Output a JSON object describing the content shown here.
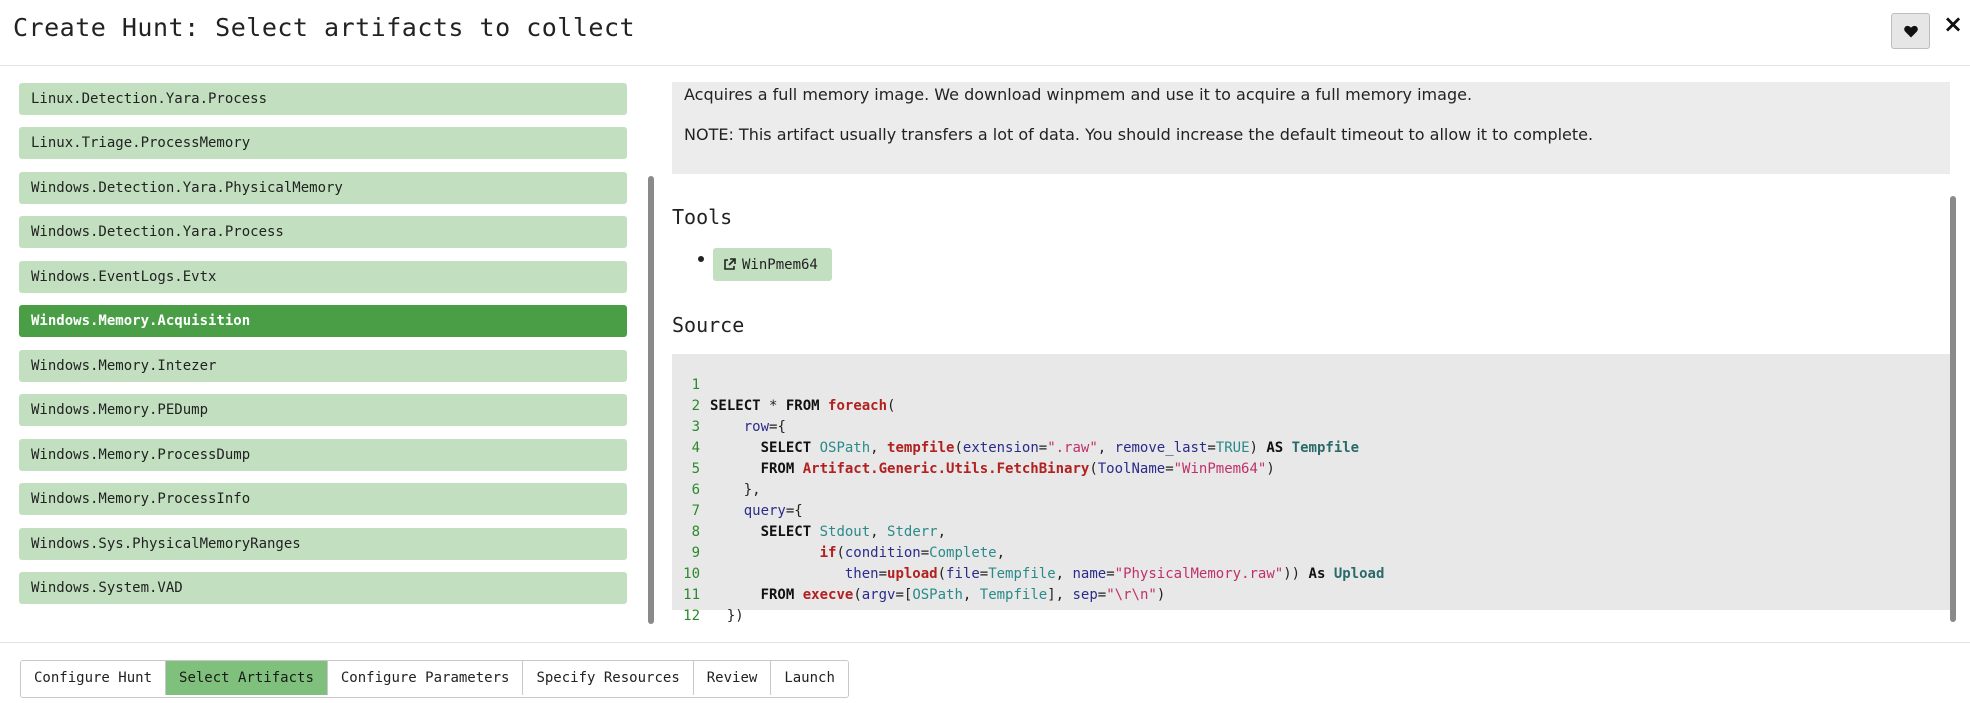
{
  "header": {
    "title": "Create Hunt: Select artifacts to collect",
    "favorite_icon": "heart-icon",
    "close_label": "×"
  },
  "artifacts": [
    {
      "label": "Linux.Detection.Yara.Process",
      "selected": false
    },
    {
      "label": "Linux.Triage.ProcessMemory",
      "selected": false
    },
    {
      "label": "Windows.Detection.Yara.PhysicalMemory",
      "selected": false
    },
    {
      "label": "Windows.Detection.Yara.Process",
      "selected": false
    },
    {
      "label": "Windows.EventLogs.Evtx",
      "selected": false
    },
    {
      "label": "Windows.Memory.Acquisition",
      "selected": true
    },
    {
      "label": "Windows.Memory.Intezer",
      "selected": false
    },
    {
      "label": "Windows.Memory.PEDump",
      "selected": false
    },
    {
      "label": "Windows.Memory.ProcessDump",
      "selected": false
    },
    {
      "label": "Windows.Memory.ProcessInfo",
      "selected": false
    },
    {
      "label": "Windows.Sys.PhysicalMemoryRanges",
      "selected": false
    },
    {
      "label": "Windows.System.VAD",
      "selected": false
    }
  ],
  "description": {
    "paragraph1": "Acquires a full memory image. We download winpmem and use it to acquire a full memory image.",
    "paragraph2": "NOTE: This artifact usually transfers a lot of data. You should increase the default timeout to allow it to complete."
  },
  "tools": {
    "heading": "Tools",
    "items": [
      {
        "label": "WinPmem64",
        "icon": "external-link-icon"
      }
    ]
  },
  "source": {
    "heading": "Source",
    "line_numbers": [
      "1",
      "2",
      "3",
      "4",
      "5",
      "6",
      "7",
      "8",
      "9",
      "10",
      "11",
      "12"
    ]
  },
  "footer": {
    "tabs": [
      {
        "label": "Configure Hunt",
        "active": false
      },
      {
        "label": "Select Artifacts",
        "active": true
      },
      {
        "label": "Configure Parameters",
        "active": false
      },
      {
        "label": "Specify Resources",
        "active": false
      },
      {
        "label": "Review",
        "active": false
      },
      {
        "label": "Launch",
        "active": false
      }
    ]
  },
  "colors": {
    "artifact_bg": "#c2e0c0",
    "artifact_selected_bg": "#4a9f46",
    "active_tab_bg": "#7fc17c",
    "code_bg": "#e8e8e8"
  }
}
